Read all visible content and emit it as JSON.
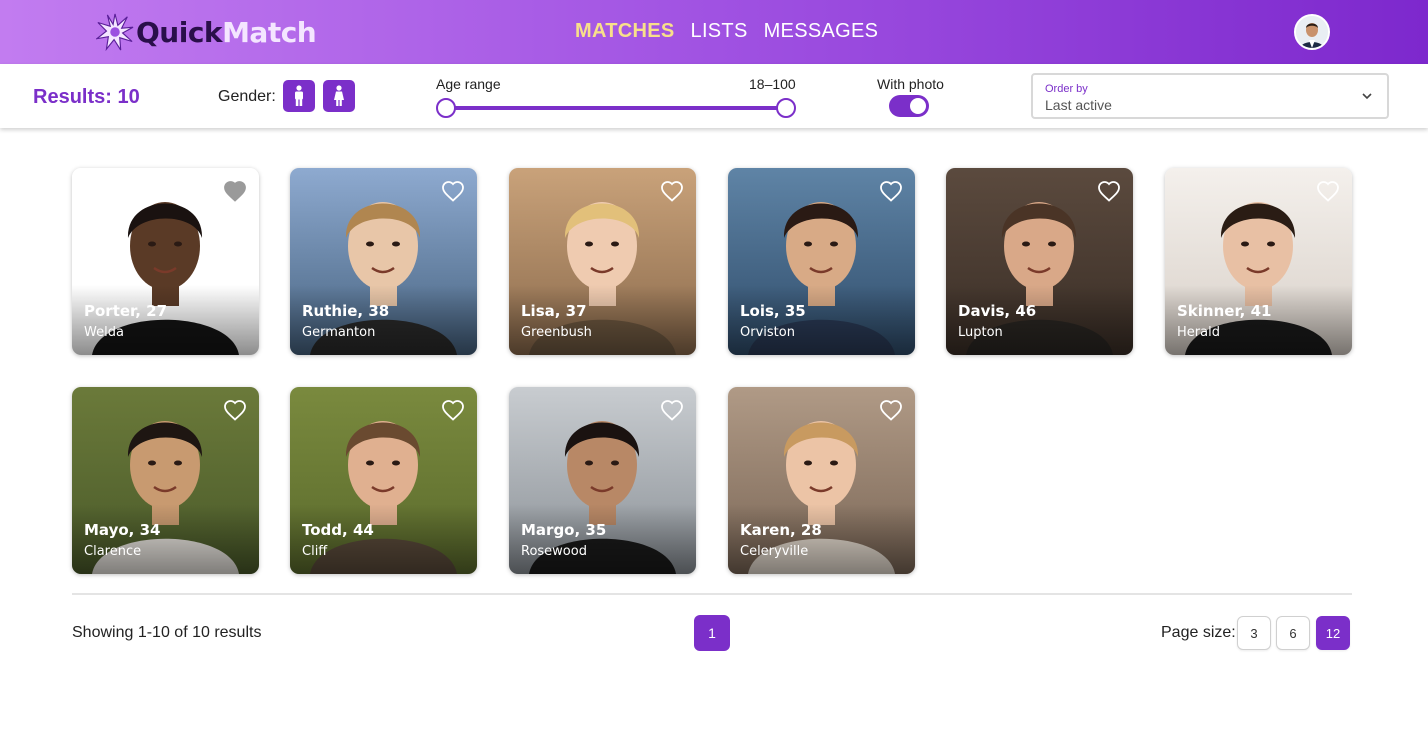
{
  "brand": {
    "name_part1": "Quick",
    "name_part2": "Match",
    "logo_icon": "starburst-icon"
  },
  "nav": {
    "items": [
      {
        "label": "MATCHES",
        "active": true
      },
      {
        "label": "LISTS",
        "active": false
      },
      {
        "label": "MESSAGES",
        "active": false
      }
    ]
  },
  "user": {
    "avatar_icon": "user-avatar"
  },
  "filters": {
    "results_label": "Results: 10",
    "gender_label": "Gender:",
    "gender_options": [
      "male-icon",
      "female-icon"
    ],
    "age_label": "Age range",
    "age_value": "18–100",
    "age_min": 18,
    "age_max": 100,
    "with_photo_label": "With photo",
    "with_photo_on": true,
    "order_label": "Order by",
    "order_value": "Last active"
  },
  "cards": [
    {
      "name": "Porter, 27",
      "city": "Welda",
      "favorite": true
    },
    {
      "name": "Ruthie, 38",
      "city": "Germanton",
      "favorite": false
    },
    {
      "name": "Lisa, 37",
      "city": "Greenbush",
      "favorite": false
    },
    {
      "name": "Lois, 35",
      "city": "Orviston",
      "favorite": false
    },
    {
      "name": "Davis, 46",
      "city": "Lupton",
      "favorite": false
    },
    {
      "name": "Skinner, 41",
      "city": "Herald",
      "favorite": false
    },
    {
      "name": "Mayo, 34",
      "city": "Clarence",
      "favorite": false
    },
    {
      "name": "Todd, 44",
      "city": "Cliff",
      "favorite": false
    },
    {
      "name": "Margo, 35",
      "city": "Rosewood",
      "favorite": false
    },
    {
      "name": "Karen, 28",
      "city": "Celeryville",
      "favorite": false
    }
  ],
  "footer": {
    "showing": "Showing 1-10 of 10 results",
    "current_page": "1",
    "page_size_label": "Page size:",
    "page_sizes": [
      "3",
      "6",
      "12"
    ],
    "selected_page_size": "12"
  },
  "colors": {
    "accent": "#7b2fc9",
    "nav_active": "#f8e08a"
  }
}
